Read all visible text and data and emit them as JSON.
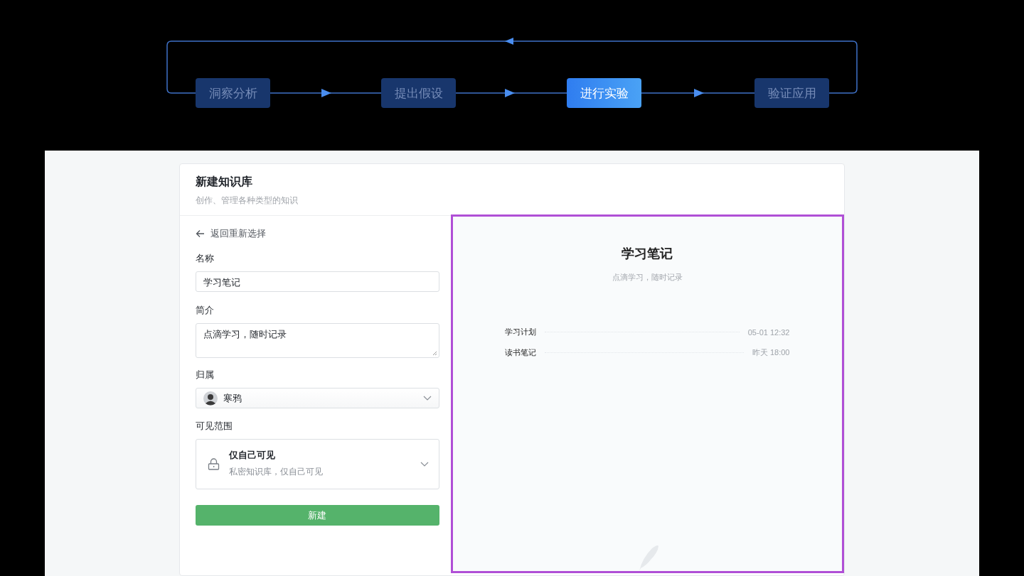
{
  "flow": {
    "steps": [
      {
        "label": "洞察分析",
        "selected": false
      },
      {
        "label": "提出假设",
        "selected": false
      },
      {
        "label": "进行实验",
        "selected": true
      },
      {
        "label": "验证应用",
        "selected": false
      }
    ]
  },
  "dialog": {
    "title": "新建知识库",
    "subtitle": "创作、管理各种类型的知识"
  },
  "form": {
    "back_link": "返回重新选择",
    "name": {
      "label": "名称",
      "value": "学习笔记"
    },
    "description": {
      "label": "简介",
      "value": "点滴学习，随时记录"
    },
    "owner": {
      "label": "归属",
      "value": "寒鸦"
    },
    "visibility": {
      "label": "可见范围",
      "title": "仅自己可见",
      "description": "私密知识库，仅自己可见"
    },
    "submit": "新建"
  },
  "preview": {
    "title": "学习笔记",
    "subtitle": "点滴学习，随时记录",
    "docs": [
      {
        "title": "学习计划",
        "time": "05-01 12:32"
      },
      {
        "title": "读书笔记",
        "time": "昨天 18:00"
      }
    ]
  }
}
